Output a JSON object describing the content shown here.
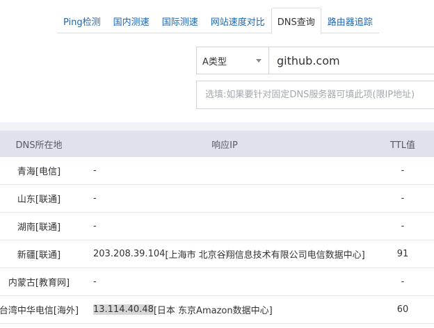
{
  "tabs": [
    {
      "label": "Ping检测"
    },
    {
      "label": "国内测速"
    },
    {
      "label": "国际测速"
    },
    {
      "label": "网站速度对比"
    },
    {
      "label": "DNS查询"
    },
    {
      "label": "路由器追踪"
    }
  ],
  "active_tab": "DNS查询",
  "query": {
    "type_selected": "A类型",
    "domain_value": "github.com",
    "dns_server_placeholder": "选填:如果要针对固定DNS服务器可填此项(限IP地址)"
  },
  "table": {
    "headers": {
      "location": "DNS所在地",
      "ip": "响应IP",
      "ttl": "TTL值"
    },
    "rows": [
      {
        "location": "青海[电信]",
        "ip": "-",
        "ip_note": "",
        "ttl": "-"
      },
      {
        "location": "山东[联通]",
        "ip": "-",
        "ip_note": "",
        "ttl": "-"
      },
      {
        "location": "湖南[联通]",
        "ip": "-",
        "ip_note": "",
        "ttl": "-"
      },
      {
        "location": "新疆[联通]",
        "ip": "203.208.39.104",
        "ip_note": " [上海市 北京谷翔信息技术有限公司电信数据中心]",
        "ttl": "91"
      },
      {
        "location": "内蒙古[教育网]",
        "ip": "-",
        "ip_note": "",
        "ttl": "-"
      },
      {
        "location": "台湾中华电信[海外]",
        "ip": "13.114.40.48",
        "ip_note": " [日本 东京Amazon数据中心]",
        "ttl": "60",
        "ip_highlighted": true
      }
    ]
  }
}
